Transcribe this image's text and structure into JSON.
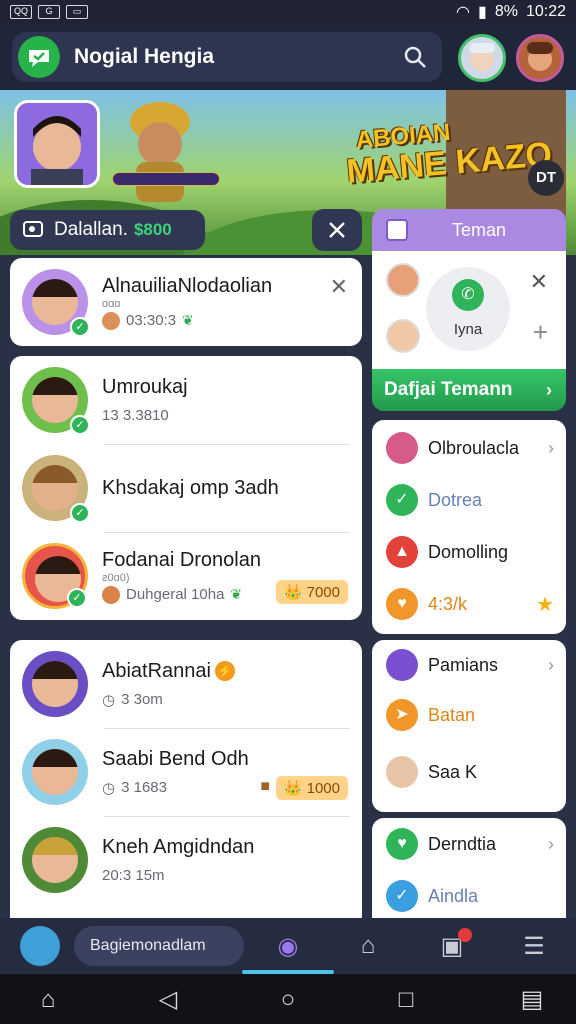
{
  "status_bar": {
    "left_icons": [
      "QQ",
      "G",
      "clip"
    ],
    "battery": "8%",
    "time": "10:22"
  },
  "header": {
    "app_title": "Nogial Hengia",
    "search_icon": "search-icon"
  },
  "banner": {
    "game_title_line1": "ABOIAN",
    "game_title_line2": "MANE KAZO",
    "badge": "DT"
  },
  "section": {
    "label": "Dalallan.",
    "count": "$800"
  },
  "contacts_top": [
    {
      "name": "AlnauiliaNlodaolian",
      "subtitle": "ɑɑɑ",
      "meta": "03:30:3",
      "has_close": true
    }
  ],
  "contacts_group1": [
    {
      "name": "Umroukaj",
      "meta": "13 3.3810"
    },
    {
      "name": "Khsdakaj omp 3adh",
      "meta": ""
    },
    {
      "name": "Fodanai Dronolan",
      "subtitle": "ƨ0ɑ0)",
      "meta": "Duhgeral 10ha",
      "coin": "7000"
    }
  ],
  "contacts_group2": [
    {
      "name": "AbiatRannai",
      "meta": "3 3om"
    },
    {
      "name": "Saabi Bend Odh",
      "meta": "3 1683",
      "coin": "1000"
    },
    {
      "name": "Kneh Amgidndan",
      "meta": "20:3 15m"
    }
  ],
  "teman": {
    "header": "Teman",
    "call_label": "Iyna",
    "button": "Dafjai Temann"
  },
  "right_group1": [
    {
      "label": "Olbroulacla",
      "icon": "avatar-icon"
    },
    {
      "label": "Dotrea",
      "icon": "check-icon"
    },
    {
      "label": "Domolling",
      "icon": "bell-icon"
    },
    {
      "label": "4:3/k",
      "icon": "heart-icon"
    }
  ],
  "right_group2": [
    {
      "label": "Pamians",
      "icon": "avatar-icon"
    },
    {
      "label": "Batan",
      "icon": "send-icon"
    },
    {
      "label": "Saa K",
      "icon": "avatar-icon"
    }
  ],
  "right_group3": [
    {
      "label": "Derndtia",
      "icon": "heart-icon"
    },
    {
      "label": "Aindla",
      "icon": "check-icon"
    }
  ],
  "bottom_nav": {
    "search_text": "Bagiemonadlam"
  },
  "colors": {
    "accent_purple": "#a989e2",
    "accent_green": "#2fb45a",
    "header_bg": "#20263a"
  }
}
